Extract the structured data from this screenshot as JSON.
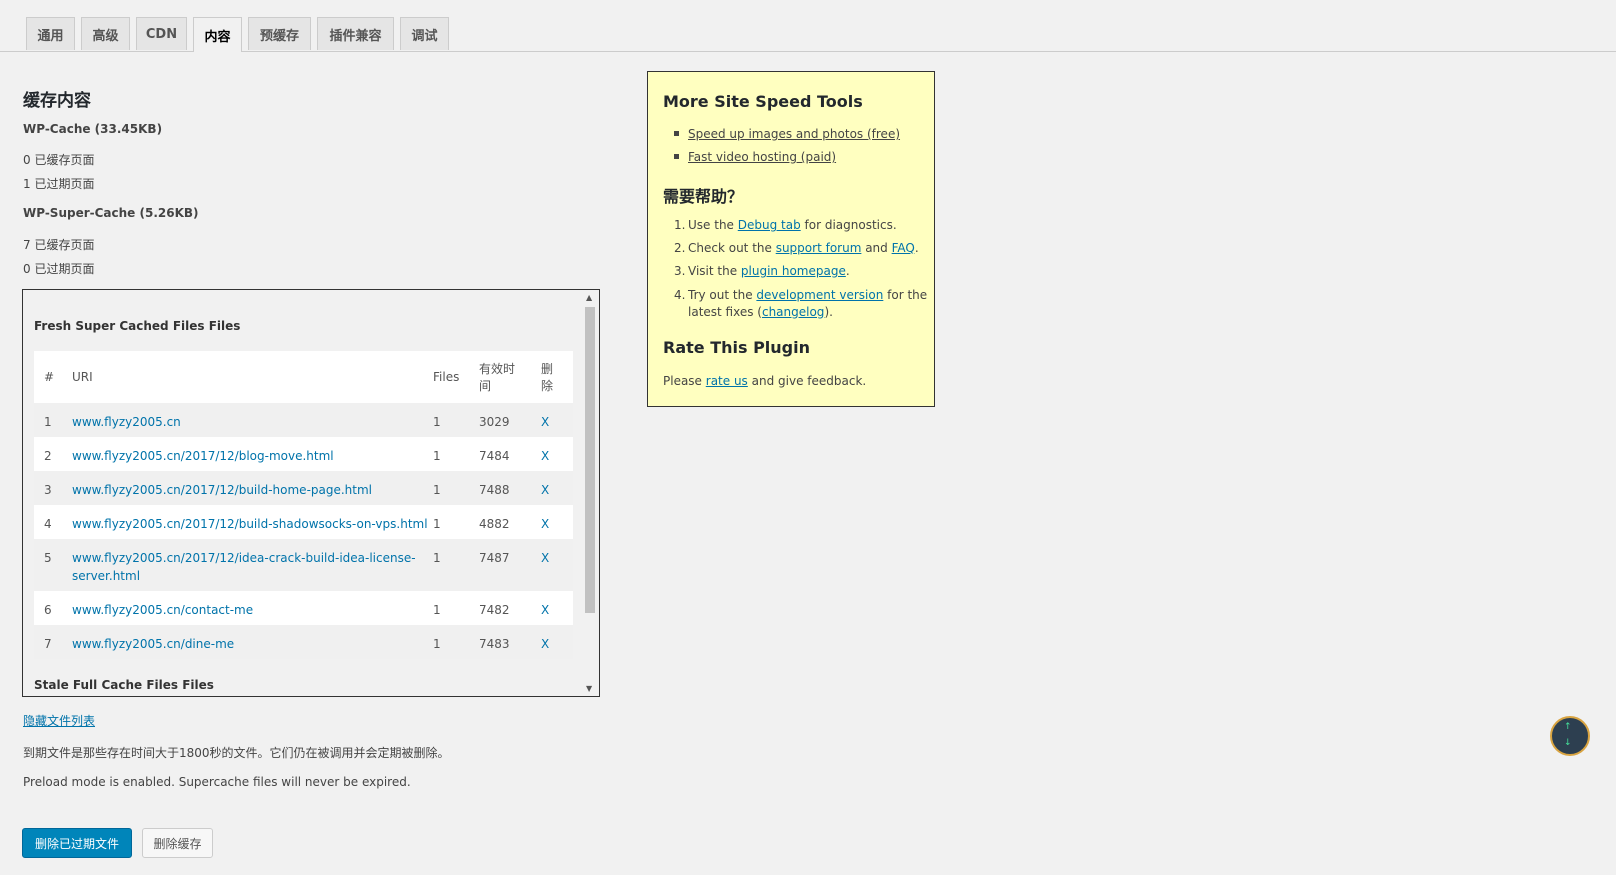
{
  "tabs": [
    {
      "label": "通用"
    },
    {
      "label": "高级"
    },
    {
      "label": "CDN"
    },
    {
      "label": "内容",
      "active": true
    },
    {
      "label": "预缓存"
    },
    {
      "label": "插件兼容"
    },
    {
      "label": "调试"
    }
  ],
  "cache": {
    "title": "缓存内容",
    "wp_cache_label": "WP-Cache (33.45KB)",
    "wp_cache_cached": "0 已缓存页面",
    "wp_cache_expired": "1 已过期页面",
    "super_cache_label": "WP-Super-Cache (5.26KB)",
    "super_cache_cached": "7 已缓存页面",
    "super_cache_expired": "0 已过期页面"
  },
  "filebox": {
    "fresh_title": "Fresh Super Cached Files Files",
    "stale_title": "Stale Full Cache Files Files",
    "headers": {
      "num": "#",
      "uri": "URI",
      "files": "Files",
      "age_1": "有效时",
      "age_2": "间",
      "del_1": "删",
      "del_2": "除"
    },
    "rows": [
      {
        "num": "1",
        "uri": "www.flyzy2005.cn",
        "files": "1",
        "age": "3029",
        "del": "X"
      },
      {
        "num": "2",
        "uri": "www.flyzy2005.cn/2017/12/blog-move.html",
        "files": "1",
        "age": "7484",
        "del": "X"
      },
      {
        "num": "3",
        "uri": "www.flyzy2005.cn/2017/12/build-home-page.html",
        "files": "1",
        "age": "7488",
        "del": "X"
      },
      {
        "num": "4",
        "uri": "www.flyzy2005.cn/2017/12/build-shadowsocks-on-vps.html",
        "files": "1",
        "age": "4882",
        "del": "X"
      },
      {
        "num": "5",
        "uri_1": "www.flyzy2005.cn/2017/12/idea-crack-build-idea-license-",
        "uri_2": "server.html",
        "files": "1",
        "age": "7487",
        "del": "X"
      },
      {
        "num": "6",
        "uri": "www.flyzy2005.cn/contact-me",
        "files": "1",
        "age": "7482",
        "del": "X"
      },
      {
        "num": "7",
        "uri": "www.flyzy2005.cn/dine-me",
        "files": "1",
        "age": "7483",
        "del": "X"
      }
    ]
  },
  "hide_link": "隐藏文件列表",
  "expired_note": "到期文件是那些存在时间大于1800秒的文件。它们仍在被调用并会定期被删除。",
  "preload_note": "Preload mode is enabled. Supercache files will never be expired.",
  "buttons": {
    "delete_expired": "删除已过期文件",
    "delete_cache": "删除缓存"
  },
  "sidebar": {
    "tools_title": "More Site Speed Tools",
    "tool_1": "Speed up images and photos (free)",
    "tool_2": "Fast video hosting (paid)",
    "help_title": "需要帮助？",
    "step_1_num": "1.",
    "step_1_pre": "Use the ",
    "step_1_link": "Debug tab",
    "step_1_post": " for diagnostics.",
    "step_2_num": "2.",
    "step_2_pre": "Check out the ",
    "step_2_link1": "support forum",
    "step_2_mid": " and ",
    "step_2_link2": "FAQ",
    "step_2_post": ".",
    "step_3_num": "3.",
    "step_3_pre": "Visit the ",
    "step_3_link": "plugin homepage",
    "step_3_post": ".",
    "step_4_num": "4.",
    "step_4_pre": "Try out the ",
    "step_4_link": "development version",
    "step_4_post": " for the",
    "step_4b_pre": "latest fixes (",
    "step_4b_link": "changelog",
    "step_4b_post": ").",
    "rate_title": "Rate This Plugin",
    "rate_pre": "Please ",
    "rate_link": "rate us",
    "rate_post": " and give feedback."
  },
  "widget": {
    "up": "↑",
    "down": "↓"
  }
}
